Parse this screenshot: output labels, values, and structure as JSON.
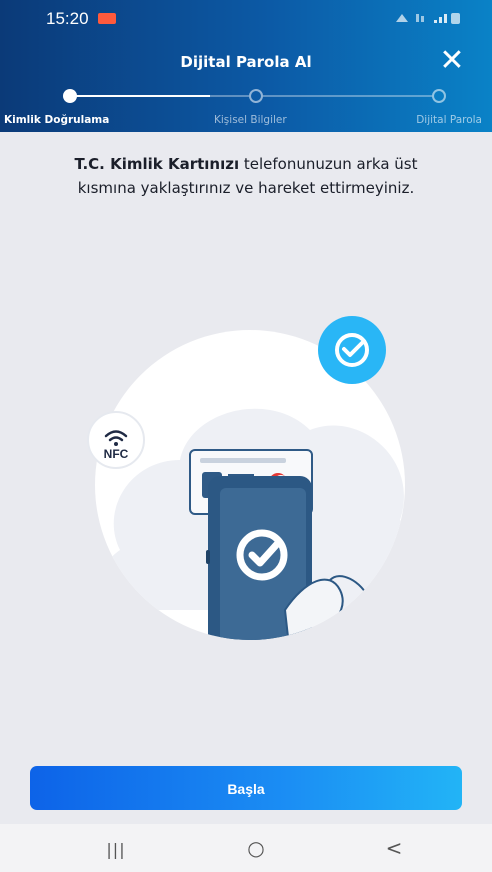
{
  "status_bar": {
    "time": "15:20"
  },
  "header": {
    "title": "Dijital Parola Al",
    "close_glyph": "✕"
  },
  "steps": [
    {
      "label": "Kimlik Doğrulama",
      "state": "active"
    },
    {
      "label": "Kişisel Bilgiler",
      "state": "inactive"
    },
    {
      "label": "Dijital Parola",
      "state": "inactive"
    }
  ],
  "instruction": {
    "bold": "T.C. Kimlik Kartınızı",
    "rest": " telefonunuzun arka üst kısmına yaklaştırınız ve hareket ettirmeyiniz."
  },
  "illustration": {
    "nfc_label": "NFC",
    "icons": [
      "check-badge-icon",
      "nfc-icon",
      "id-card-icon",
      "phone-icon"
    ]
  },
  "start_button": {
    "label": "Başla"
  },
  "nav": {
    "recents": "|||",
    "home": "○",
    "back": "<"
  },
  "colors": {
    "header_start": "#0b3a78",
    "header_end": "#0a82c7",
    "accent": "#1b8ef4",
    "check_badge": "#29b6f6"
  }
}
